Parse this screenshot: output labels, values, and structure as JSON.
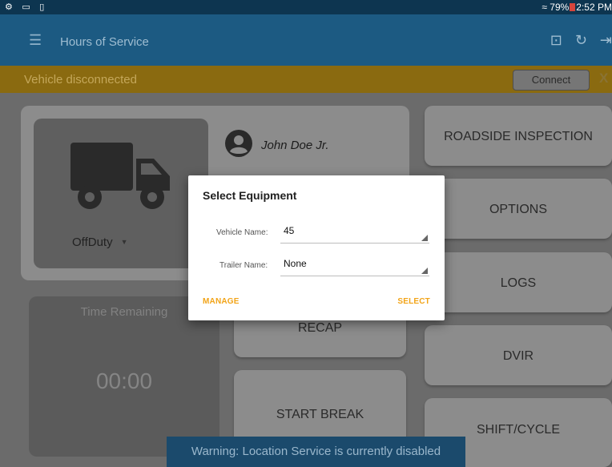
{
  "status_bar": {
    "left_icons": "⚙ ▭ ▯",
    "wifi_icon": "wifi-icon",
    "battery_text": "79%",
    "time": "2:52 PM"
  },
  "app_bar": {
    "menu_icon": "hamburger-menu-icon",
    "title": "Hours of Service",
    "icons": [
      "equipment-icon",
      "refresh-icon",
      "logout-icon"
    ]
  },
  "banner": {
    "message": "Vehicle disconnected",
    "connect_label": "Connect",
    "close_label": "X"
  },
  "vehicle": {
    "status": "OffDuty"
  },
  "driver": {
    "name": "John Doe Jr."
  },
  "time_card": {
    "label": "Time Remaining",
    "value": "00:00"
  },
  "buttons": {
    "recap": "RECAP",
    "start_break": "START BREAK",
    "roadside_inspection": "ROADSIDE INSPECTION",
    "options": "OPTIONS",
    "logs": "LOGS",
    "dvir": "DVIR",
    "shift_cycle": "SHIFT/CYCLE"
  },
  "dialog": {
    "title": "Select Equipment",
    "vehicle_label": "Vehicle Name:",
    "vehicle_value": "45",
    "trailer_label": "Trailer Name:",
    "trailer_value": "None",
    "manage_label": "MANAGE",
    "select_label": "SELECT"
  },
  "toast": {
    "message": "Warning: Location Service is currently disabled"
  },
  "colors": {
    "app_bar": "#1c5a82",
    "banner": "#8a6a10",
    "accent": "#f2a418",
    "status_bar": "#0d3550"
  }
}
